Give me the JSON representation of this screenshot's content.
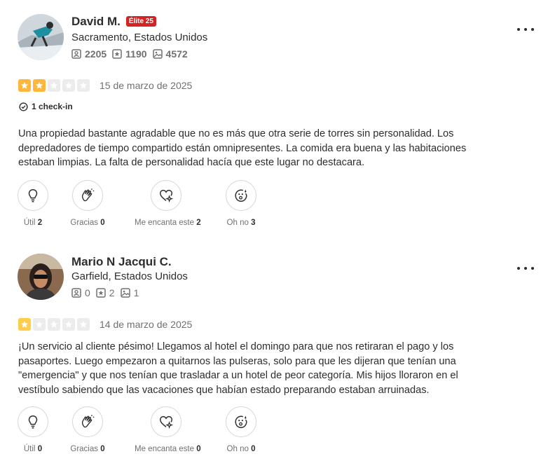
{
  "reviews": [
    {
      "author": "David M.",
      "elite_badge": "Élite 25",
      "location": "Sacramento, Estados Unidos",
      "friends": "2205",
      "reviews_count": "1190",
      "photos": "4572",
      "rating": 2,
      "date": "15 de marzo de 2025",
      "checkin": "1 check-in",
      "text": "Una propiedad bastante agradable que no es más que otra serie de torres sin personalidad. Los depredadores de tiempo compartido están omnipresentes. La comida era buena y las habitaciones estaban limpias. La falta de personalidad hacía que este lugar no destacara.",
      "reactions": {
        "useful_label": "Útil",
        "useful_count": "2",
        "thanks_label": "Gracias",
        "thanks_count": "0",
        "love_label": "Me encanta este",
        "love_count": "2",
        "ohno_label": "Oh no",
        "ohno_count": "3"
      }
    },
    {
      "author": "Mario N Jacqui C.",
      "location": "Garfield, Estados Unidos",
      "friends": "0",
      "reviews_count": "2",
      "photos": "1",
      "rating": 1,
      "date": "14 de marzo de 2025",
      "text": "¡Un servicio al cliente pésimo! Llegamos al hotel el domingo para que nos retiraran el pago y los pasaportes. Luego empezaron a quitarnos las pulseras, solo para que les dijeran que tenían una \"emergencia\" y que nos tenían que trasladar a un hotel de peor categoría. Mis hijos lloraron en el vestíbulo sabiendo que las vacaciones que habían estado preparando estaban arruinadas.",
      "reactions": {
        "useful_label": "Útil",
        "useful_count": "0",
        "thanks_label": "Gracias",
        "thanks_count": "0",
        "love_label": "Me encanta este",
        "love_count": "0",
        "ohno_label": "Oh no",
        "ohno_count": "0"
      }
    }
  ],
  "colors": {
    "star_two": "#ffb73b",
    "star_one": "#ffcc4b",
    "star_empty": "#e8e8e8",
    "elite_red": "#d32323"
  },
  "icons": {
    "friends": "friends-icon",
    "reviews": "star-square-icon",
    "photos": "photo-icon",
    "checkin": "check-circle-icon",
    "useful": "lightbulb-icon",
    "thanks": "clapping-hands-icon",
    "love": "heart-sparkle-icon",
    "ohno": "shocked-face-icon",
    "more": "more-options-icon"
  }
}
